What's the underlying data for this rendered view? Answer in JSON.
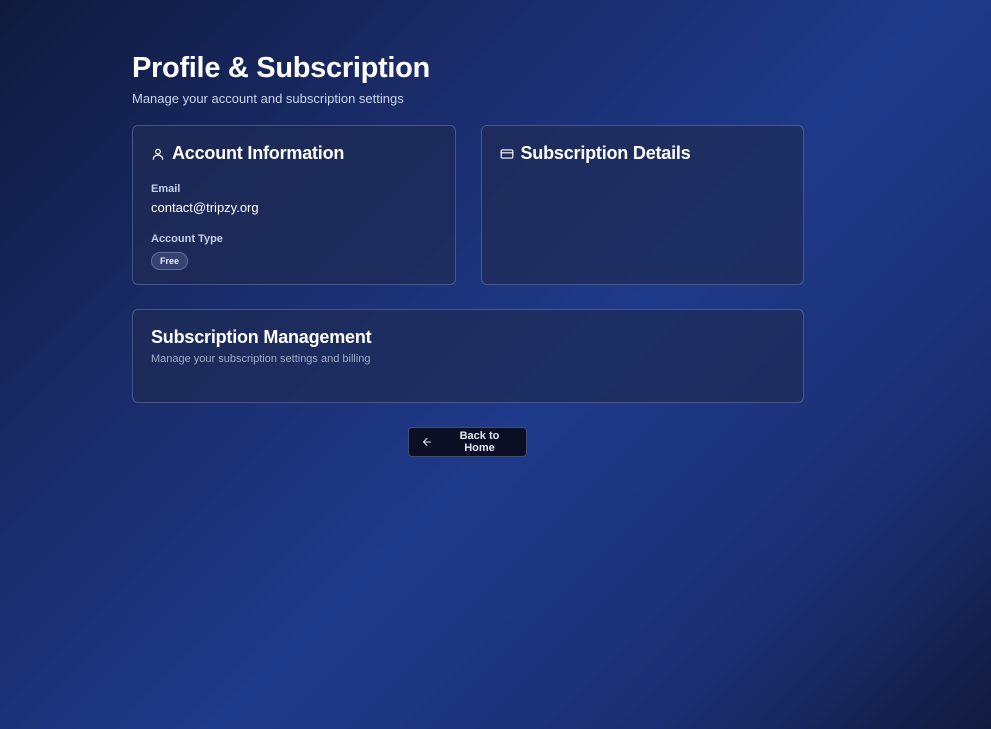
{
  "header": {
    "title": "Profile & Subscription",
    "subtitle": "Manage your account and subscription settings"
  },
  "account_card": {
    "title": "Account Information",
    "icon": "user-icon",
    "email_label": "Email",
    "email_value": "contact@tripzy.org",
    "account_type_label": "Account Type",
    "account_type_value": "Free"
  },
  "subscription_card": {
    "title": "Subscription Details",
    "icon": "credit-card-icon"
  },
  "management_card": {
    "title": "Subscription Management",
    "subtitle": "Manage your subscription settings and billing"
  },
  "actions": {
    "back_label": "Back to Home",
    "back_icon": "arrow-left-icon"
  }
}
